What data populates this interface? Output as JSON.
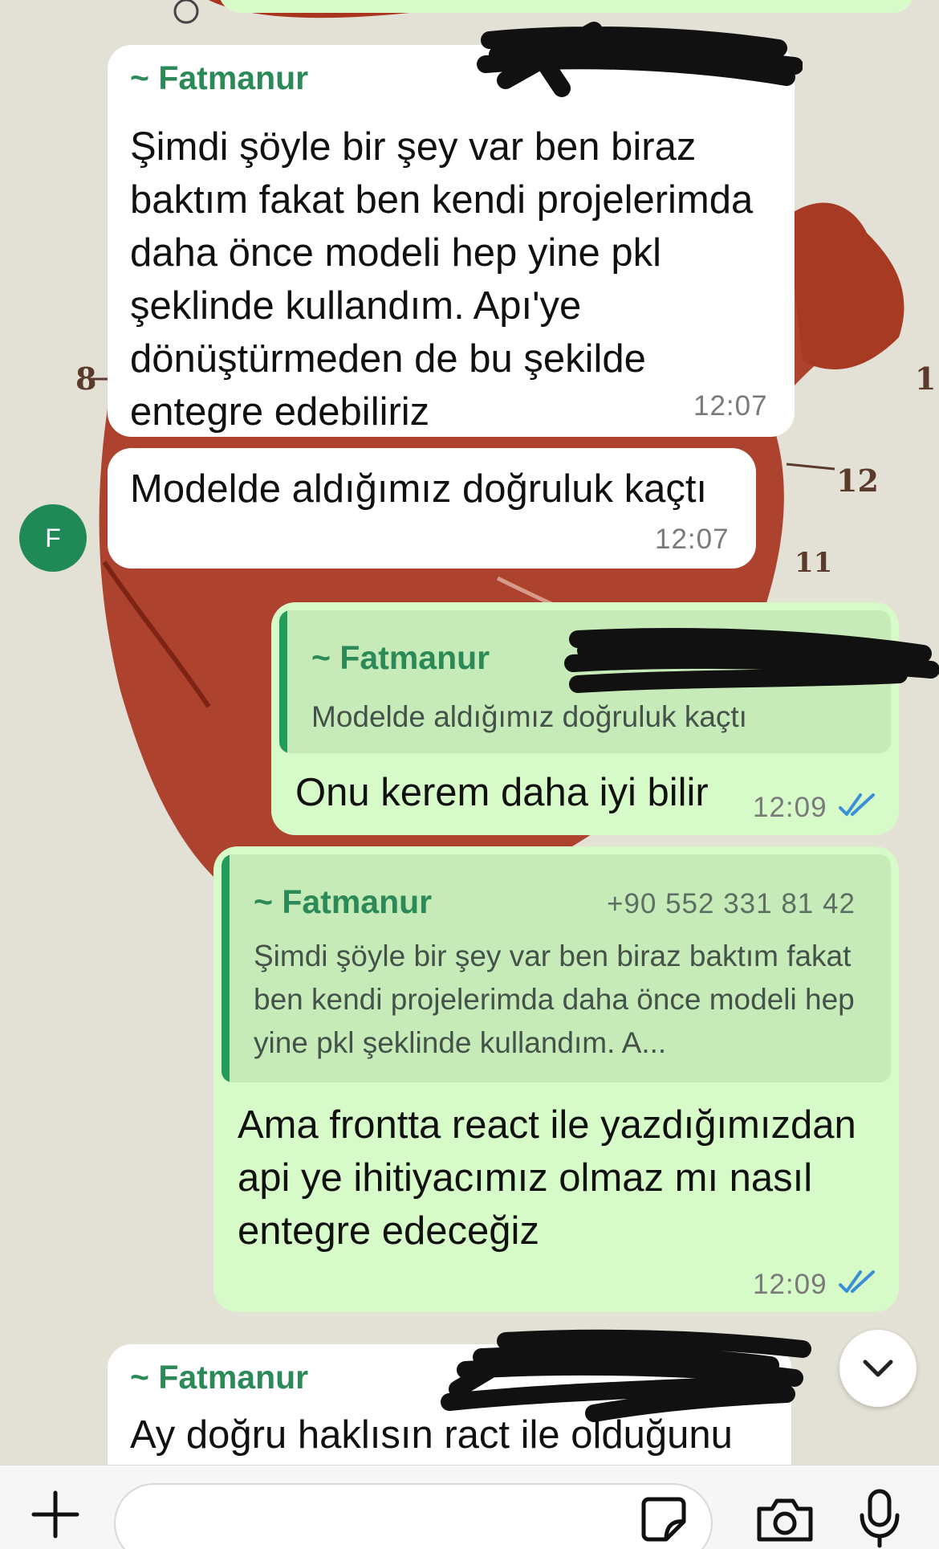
{
  "theme": {
    "accent": "#2b8a57",
    "incoming_bubble": "#ffffff",
    "outgoing_bubble": "#d7fbc8",
    "quote_bg": "#c6ebb8",
    "read_ticks": "#3a8fd8"
  },
  "messages": [
    {
      "direction": "in",
      "sender": "~ Fatmanur",
      "text": "Şimdi şöyle bir şey var ben biraz baktım fakat ben kendi projelerimda daha önce modeli hep yine pkl şeklinde kullandım. Apı'ye dönüştürmeden de bu şekilde entegre edebiliriz",
      "time": "12:07"
    },
    {
      "direction": "in",
      "text": "Modelde aldığımız doğruluk kaçtı",
      "time": "12:07",
      "avatar": "F"
    },
    {
      "direction": "out",
      "quote": {
        "sender": "~ Fatmanur",
        "text": "Modelde aldığımız doğruluk kaçtı"
      },
      "text": "Onu kerem daha iyi bilir",
      "time": "12:09",
      "status": "read"
    },
    {
      "direction": "out",
      "quote": {
        "sender": "~ Fatmanur",
        "phone": "+90 552 331 81 42",
        "text": "Şimdi şöyle bir şey var ben biraz baktım fakat ben kendi projelerimda daha önce modeli hep yine pkl şeklinde kullandım. A..."
      },
      "text": "Ama frontta react ile yazdığımızdan api ye ihitiyacımız olmaz mı nasıl entegre edeceğiz",
      "time": "12:09",
      "status": "read"
    },
    {
      "direction": "in",
      "sender": "~ Fatmanur",
      "text": "Ay doğru haklısın ract ile olduğunu"
    }
  ],
  "composer": {
    "value": "",
    "placeholder": "",
    "icons": [
      "plus-icon",
      "sticker-icon",
      "camera-icon",
      "microphone-icon"
    ]
  },
  "scroll_button_icon": "chevron-down-icon"
}
